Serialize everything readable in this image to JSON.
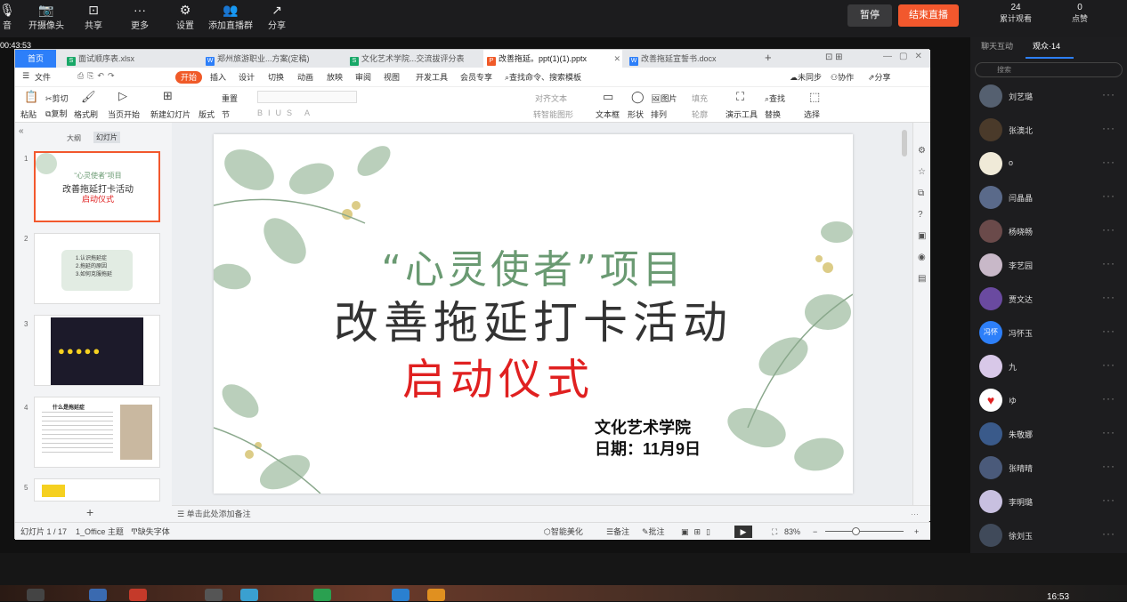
{
  "meeting": {
    "tools": [
      {
        "label": "音",
        "icon": "mic-icon",
        "glyph": "🎙"
      },
      {
        "label": "开摄像头",
        "icon": "camera-icon",
        "glyph": "📷"
      },
      {
        "label": "共享",
        "icon": "share-screen-icon",
        "glyph": "⊡"
      },
      {
        "label": "更多",
        "icon": "more-icon",
        "glyph": "···"
      },
      {
        "label": "设置",
        "icon": "settings-icon",
        "glyph": "⚙"
      },
      {
        "label": "添加直播群",
        "icon": "add-group-icon",
        "glyph": "👥"
      },
      {
        "label": "分享",
        "icon": "share-icon",
        "glyph": "↗"
      }
    ],
    "pause_label": "暂停",
    "end_label": "结束直播",
    "stats": [
      {
        "num": "24",
        "label": "累计观看"
      },
      {
        "num": "0",
        "label": "点赞"
      }
    ],
    "timer": "00:43:53"
  },
  "wps": {
    "home_tab": "首页",
    "tabs": [
      {
        "label": "面试顺序表.xlsx",
        "type": "S",
        "color": "#19a868",
        "active": false
      },
      {
        "label": "郑州旅游职业...方案(定稿)",
        "type": "W",
        "color": "#2d7ff9",
        "active": false
      },
      {
        "label": "文化艺术学院...交流拔评分表",
        "type": "S",
        "color": "#19a868",
        "active": false
      },
      {
        "label": "改善拖延。ppt(1)(1).pptx",
        "type": "P",
        "color": "#f05a28",
        "active": true
      },
      {
        "label": "改善拖延宣誓书.docx",
        "type": "W",
        "color": "#2d7ff9",
        "active": false
      }
    ],
    "menu": [
      "文件",
      "开始",
      "插入",
      "设计",
      "切换",
      "动画",
      "放映",
      "审阅",
      "视图",
      "开发工具",
      "会员专享"
    ],
    "search_placeholder": "查找命令、搜索模板",
    "sync_label": "未同步",
    "collab_label": "协作",
    "share_label": "分享",
    "ribbon": {
      "paste": "粘贴",
      "cut": "剪切",
      "copy": "复制",
      "format_painter": "格式刷",
      "from_current": "当页开始",
      "new_slide": "新建幻灯片",
      "layout": "版式",
      "section": "节",
      "reset": "重置",
      "align_text": "对齐文本",
      "smart_shape": "转智能图形",
      "textbox": "文本框",
      "shape": "形状",
      "picture": "图片",
      "fill": "填充",
      "arrange": "排列",
      "outline": "轮廓",
      "presentation_tools": "演示工具",
      "find": "查找",
      "replace": "替换",
      "select": "选择"
    },
    "panel_tabs": [
      "大纲",
      "幻灯片"
    ],
    "thumbs": [
      {
        "num": "1",
        "line1": "“心灵使者”项目",
        "line2": "改善拖延打卡活动",
        "line3": "启动仪式"
      },
      {
        "num": "2",
        "items": [
          "1.认识拖延症",
          "2.拖延的原因",
          "3.如何克服拖延"
        ]
      },
      {
        "num": "3"
      },
      {
        "num": "4",
        "title": "什么是拖延症"
      },
      {
        "num": "5"
      }
    ],
    "slide": {
      "title1": "“心灵使者”项目",
      "title2": "改善拖延打卡活动",
      "title3": "启动仪式",
      "org": "文化艺术学院",
      "date": "日期：11月9日"
    },
    "notes_placeholder": "单击此处添加备注",
    "status": {
      "slide_count": "幻灯片 1 / 17",
      "theme": "1_Office 主题",
      "missing_font": "缺失字体",
      "beautify": "智能美化",
      "notes": "备注",
      "comments": "批注",
      "zoom": "83%"
    }
  },
  "audience": {
    "tabs": [
      "聊天互动",
      "观众·14"
    ],
    "search_placeholder": "搜索",
    "users": [
      {
        "name": "刘艺璐",
        "color": "#556070",
        "initials": ""
      },
      {
        "name": "张澳北",
        "color": "#4a3a2a",
        "initials": ""
      },
      {
        "name": "o",
        "color": "#f0ead8",
        "initials": ""
      },
      {
        "name": "闫晶晶",
        "color": "#5a6a8a",
        "initials": ""
      },
      {
        "name": "杨晓畅",
        "color": "#6a4a4a",
        "initials": ""
      },
      {
        "name": "李艺园",
        "color": "#c8b8c8",
        "initials": ""
      },
      {
        "name": "贾文达",
        "color": "#6a4aa0",
        "initials": ""
      },
      {
        "name": "冯怀玉",
        "color": "#2d7ff9",
        "initials": "冯怀"
      },
      {
        "name": "九",
        "color": "#d8c8e8",
        "initials": ""
      },
      {
        "name": "ゆ",
        "color": "#ffffff",
        "initials": "♥"
      },
      {
        "name": "朱敬娜",
        "color": "#3a5a8a",
        "initials": ""
      },
      {
        "name": "张晴晴",
        "color": "#4a5a7a",
        "initials": ""
      },
      {
        "name": "李明璐",
        "color": "#c8c0e0",
        "initials": ""
      },
      {
        "name": "徐刘玉",
        "color": "#404a5a",
        "initials": ""
      }
    ]
  },
  "clock": "16:53"
}
